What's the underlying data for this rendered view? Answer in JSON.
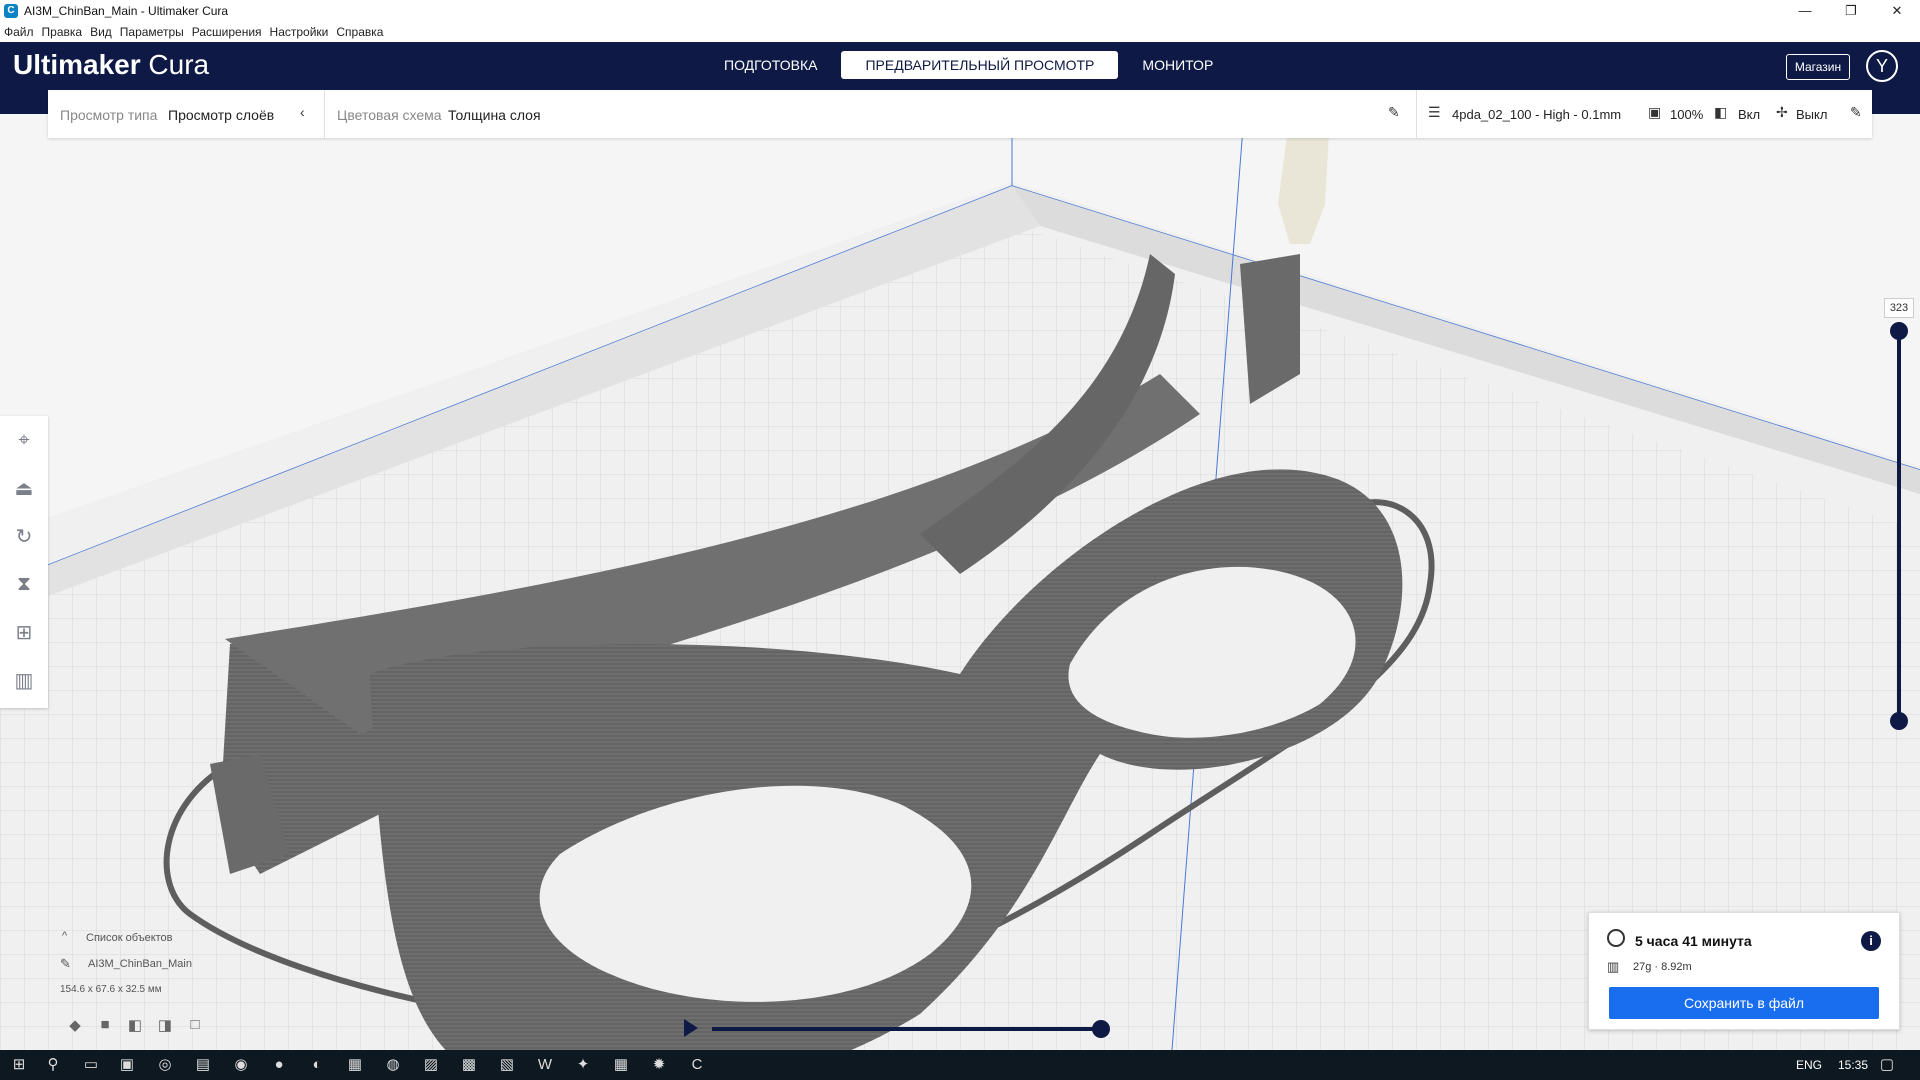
{
  "window": {
    "title": "AI3M_ChinBan_Main - Ultimaker Cura",
    "app_icon": "C",
    "controls": [
      "—",
      "❐",
      "✕"
    ]
  },
  "menu": [
    "Файл",
    "Правка",
    "Вид",
    "Параметры",
    "Расширения",
    "Настройки",
    "Справка"
  ],
  "header": {
    "logo_bold": "Ultimaker",
    "logo_light": "Cura",
    "tabs": [
      "ПОДГОТОВКА",
      "ПРЕДВАРИТЕЛЬНЫЙ ПРОСМОТР",
      "МОНИТОР"
    ],
    "active_tab": 1,
    "store": "Магазин",
    "avatar": "Y",
    "colors": {
      "header_bg": "#0e1a45",
      "accent": "#196ef0"
    }
  },
  "stage": {
    "view_type_label": "Просмотр типа",
    "view_type_value": "Просмотр слоёв",
    "color_scheme_label": "Цветовая схема",
    "color_scheme_value": "Толщина слоя",
    "profile": "4pda_02_100 - High - 0.1mm",
    "infill": "100%",
    "support": "Вкл",
    "adhesion": "Выкл"
  },
  "slider": {
    "layer": "323"
  },
  "objects": {
    "header": "Список объектов",
    "name": "AI3M_ChinBan_Main",
    "dims": "154.6 x 67.6 x 32.5 мм"
  },
  "print": {
    "time": "5 часа 41 минута",
    "material": "27g · 8.92m",
    "save": "Сохранить в файл"
  },
  "taskbar": {
    "lang": "ENG",
    "clock": "15:35"
  }
}
